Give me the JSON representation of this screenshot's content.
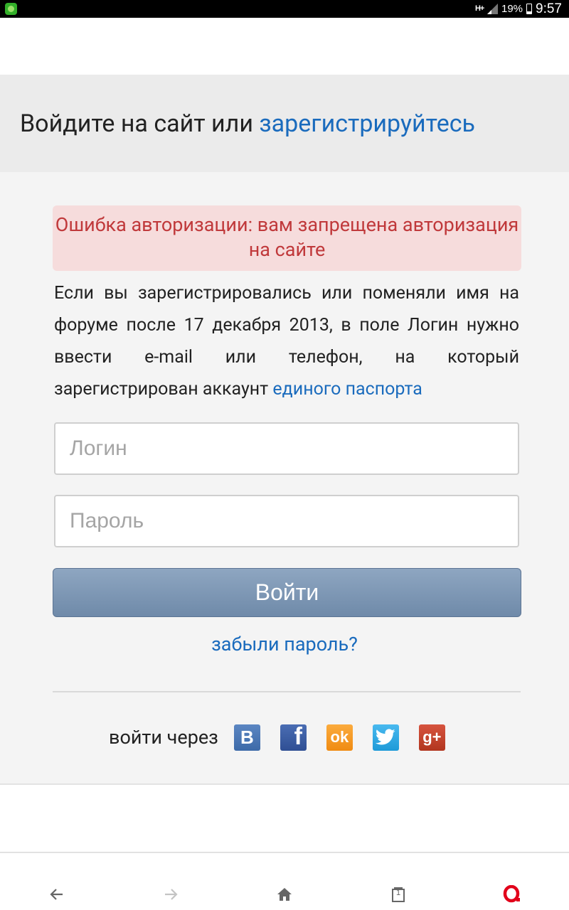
{
  "status_bar": {
    "network": "H+",
    "battery_percent": "19%",
    "time": "9:57"
  },
  "header": {
    "title_prefix": "Войдите на сайт или ",
    "register_link": "зарегистрируйтесь"
  },
  "error_message": "Ошибка авторизации: вам запрещена авторизация на сайте",
  "info": {
    "text": "Если вы зарегистрировались или поменяли имя на форуме после 17 декабря 2013, в поле Логин нужно ввести e-mail или телефон, на который зарегистрирован аккаунт ",
    "link": "единого паспорта"
  },
  "form": {
    "login_placeholder": "Логин",
    "password_placeholder": "Пароль",
    "submit_label": "Войти",
    "forgot_link": "забыли пароль?"
  },
  "social": {
    "label": "войти через",
    "networks": [
      "vk",
      "facebook",
      "odnoklassniki",
      "twitter",
      "google-plus"
    ],
    "vk_glyph": "B",
    "facebook_glyph": "f",
    "odnoklassniki_glyph": "ok",
    "google_plus_glyph": "g+"
  },
  "bottom_bar": {
    "tab_count": "1",
    "icons": [
      "back-arrow-icon",
      "forward-arrow-icon",
      "home-icon",
      "tabs-icon",
      "opera-icon"
    ]
  },
  "colors": {
    "link": "#1a6bbd",
    "error_text": "#c0393b",
    "error_bg": "#f6dcdc",
    "button": "#7a93b1",
    "opera_red": "#e2001a"
  }
}
